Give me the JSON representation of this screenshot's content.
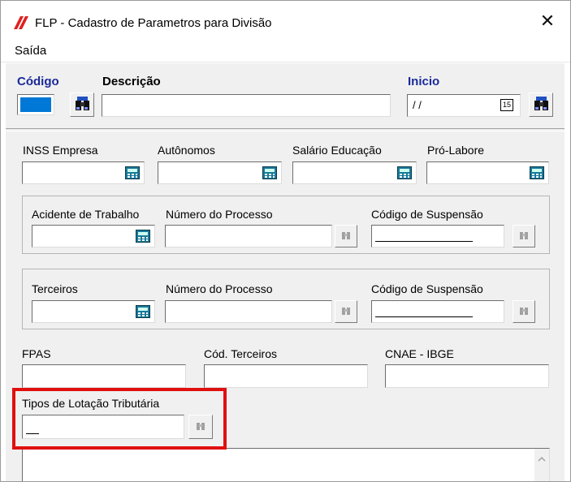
{
  "window": {
    "title": "FLP - Cadastro de Parametros para Divisão",
    "close_label": "✕"
  },
  "menu": {
    "saida": "Saída"
  },
  "header": {
    "codigo_label": "Código",
    "descricao_label": "Descrição",
    "inicio_label": "Inicio",
    "inicio_value": " / /",
    "calendar_day": "15"
  },
  "aliquotas": {
    "inss_empresa": "INSS Empresa",
    "autonomos": "Autônomos",
    "salario_educacao": "Salário Educação",
    "pro_labore": "Pró-Labore"
  },
  "acidente": {
    "label": "Acidente de Trabalho",
    "processo_label": "Número do Processo",
    "suspensao_label": "Código de Suspensão"
  },
  "terceiros": {
    "label": "Terceiros",
    "processo_label": "Número do Processo",
    "suspensao_label": "Código de Suspensão"
  },
  "fpas_row": {
    "fpas_label": "FPAS",
    "cod_terceiros_label": "Cód. Terceiros",
    "cnae_label": "CNAE - IBGE"
  },
  "lotacao": {
    "label": "Tipos de Lotação Tributária"
  },
  "colors": {
    "highlight": "#e01010",
    "codigo_field": "#0078d7",
    "label_blue": "#1a2a9a"
  }
}
